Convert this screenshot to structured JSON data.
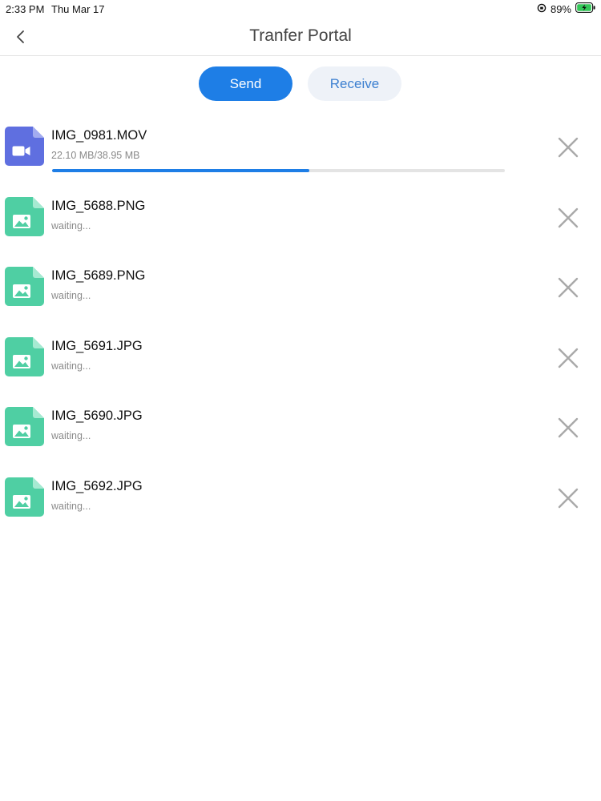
{
  "status_bar": {
    "time": "2:33 PM",
    "date": "Thu Mar 17",
    "battery": "89%"
  },
  "nav": {
    "title": "Tranfer Portal",
    "back_icon": "chevron-left-icon"
  },
  "tabs": {
    "send_label": "Send",
    "receive_label": "Receive",
    "active": "send",
    "active_color": "#1e7ee6"
  },
  "files": [
    {
      "name": "IMG_0981.MOV",
      "status": "22.10 MB/38.95 MB",
      "type": "video",
      "progress": 0.568
    },
    {
      "name": "IMG_5688.PNG",
      "status": "waiting...",
      "type": "image"
    },
    {
      "name": "IMG_5689.PNG",
      "status": "waiting...",
      "type": "image"
    },
    {
      "name": "IMG_5691.JPG",
      "status": "waiting...",
      "type": "image"
    },
    {
      "name": "IMG_5690.JPG",
      "status": "waiting...",
      "type": "image"
    },
    {
      "name": "IMG_5692.JPG",
      "status": "waiting...",
      "type": "image"
    }
  ],
  "colors": {
    "video_icon": "#5f6fe0",
    "image_icon": "#4fcfa3",
    "progress_track": "#e4e4e4"
  }
}
